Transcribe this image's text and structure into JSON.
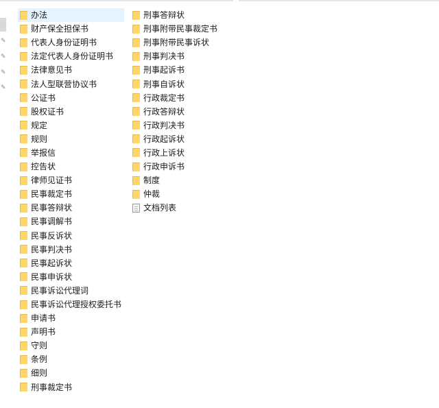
{
  "explorer": {
    "column1": [
      {
        "label": "办法",
        "icon": "folder-icon",
        "selected": true
      },
      {
        "label": "财产保全担保书",
        "icon": "folder-icon"
      },
      {
        "label": "代表人身份证明书",
        "icon": "folder-icon"
      },
      {
        "label": "法定代表人身份证明书",
        "icon": "folder-icon"
      },
      {
        "label": "法律意见书",
        "icon": "folder-icon"
      },
      {
        "label": "法人型联营协议书",
        "icon": "folder-icon"
      },
      {
        "label": "公证书",
        "icon": "folder-icon"
      },
      {
        "label": "股权证书",
        "icon": "folder-icon"
      },
      {
        "label": "规定",
        "icon": "folder-icon"
      },
      {
        "label": "规则",
        "icon": "folder-icon"
      },
      {
        "label": "举报信",
        "icon": "folder-icon"
      },
      {
        "label": "控告状",
        "icon": "folder-icon"
      },
      {
        "label": "律师见证书",
        "icon": "folder-icon"
      },
      {
        "label": "民事裁定书",
        "icon": "folder-icon"
      },
      {
        "label": "民事答辩状",
        "icon": "folder-icon"
      },
      {
        "label": "民事调解书",
        "icon": "folder-icon"
      },
      {
        "label": "民事反诉状",
        "icon": "folder-icon"
      },
      {
        "label": "民事判决书",
        "icon": "folder-icon"
      },
      {
        "label": "民事起诉状",
        "icon": "folder-icon"
      },
      {
        "label": "民事申诉状",
        "icon": "folder-icon"
      },
      {
        "label": "民事诉讼代理词",
        "icon": "folder-icon"
      },
      {
        "label": "民事诉讼代理授权委托书",
        "icon": "folder-icon"
      },
      {
        "label": "申请书",
        "icon": "folder-icon"
      },
      {
        "label": "声明书",
        "icon": "folder-icon"
      },
      {
        "label": "守则",
        "icon": "folder-icon"
      },
      {
        "label": "条例",
        "icon": "folder-icon"
      },
      {
        "label": "细则",
        "icon": "folder-icon"
      },
      {
        "label": "刑事裁定书",
        "icon": "folder-icon"
      }
    ],
    "column2": [
      {
        "label": "刑事答辩状",
        "icon": "folder-icon"
      },
      {
        "label": "刑事附带民事裁定书",
        "icon": "folder-icon"
      },
      {
        "label": "刑事附带民事诉状",
        "icon": "folder-icon"
      },
      {
        "label": "刑事判决书",
        "icon": "folder-icon"
      },
      {
        "label": "刑事起诉书",
        "icon": "folder-icon"
      },
      {
        "label": "刑事自诉状",
        "icon": "folder-icon"
      },
      {
        "label": "行政裁定书",
        "icon": "folder-icon"
      },
      {
        "label": "行政答辩状",
        "icon": "folder-icon"
      },
      {
        "label": "行政判决书",
        "icon": "folder-icon"
      },
      {
        "label": "行政起诉状",
        "icon": "folder-icon"
      },
      {
        "label": "行政上诉状",
        "icon": "folder-icon"
      },
      {
        "label": "行政申诉书",
        "icon": "folder-icon"
      },
      {
        "label": "制度",
        "icon": "folder-icon"
      },
      {
        "label": "仲裁",
        "icon": "folder-icon"
      },
      {
        "label": "文档列表",
        "icon": "document-icon"
      }
    ]
  },
  "colors": {
    "folder_front": "#ffd769",
    "folder_back": "#e6b84c",
    "selection": "#e5f3ff",
    "text": "#1a1a1a"
  }
}
